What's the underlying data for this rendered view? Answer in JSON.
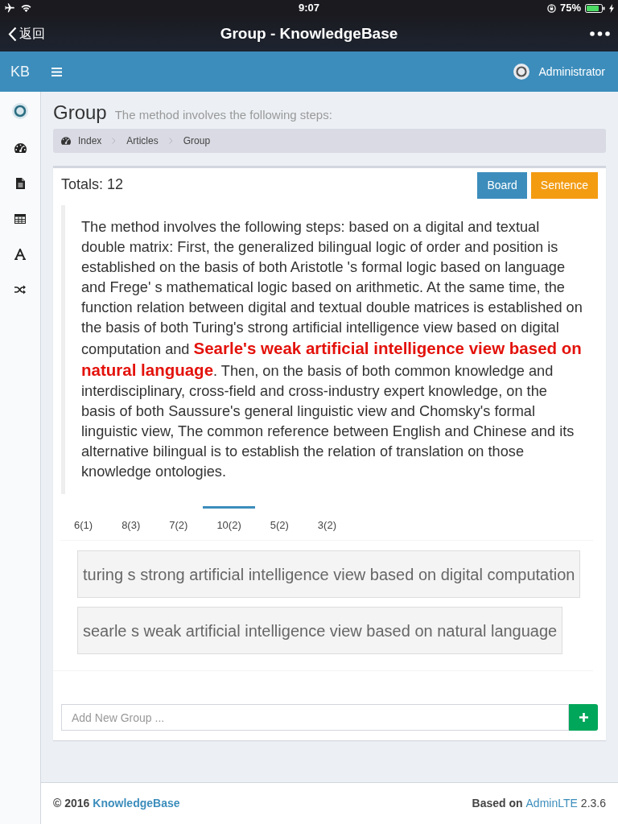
{
  "status_bar": {
    "time": "9:07",
    "battery_text": "75%"
  },
  "nav_bar": {
    "back": "返回",
    "title": "Group - KnowledgeBase"
  },
  "header": {
    "logo": "KB",
    "user": "Administrator"
  },
  "page_header": {
    "title": "Group",
    "subtitle": "The method involves the following steps:"
  },
  "breadcrumb": [
    {
      "label": "Index"
    },
    {
      "label": "Articles"
    },
    {
      "label": "Group"
    }
  ],
  "box": {
    "totals": "Totals: 12",
    "buttons": [
      {
        "label": "Board",
        "kind": "primary"
      },
      {
        "label": "Sentence",
        "kind": "warning"
      }
    ],
    "quote": "The method involves the following steps: based on a digital and textual double matrix: First, the generalized bilingual logic of order and position is established on the basis of both Aristotle 's formal logic based on language and Frege' s mathematical logic based on arithmetic. At the same time, the function relation between digital and textual double matrices is established on the basis of both Turing's strong artificial intelligence view based on digital computation and **Searle's weak artificial intelligence view based on natural language**. Then, on the basis of both common knowledge and interdisciplinary, cross-field and cross-industry expert knowledge, on the basis of both Saussure's general linguistic view and Chomsky's formal linguistic view, The common reference between English and Chinese and its alternative bilingual is to establish the relation of translation on those knowledge ontologies.",
    "tabs": [
      {
        "label": "6(1)",
        "selected": false
      },
      {
        "label": "8(3)",
        "selected": false
      },
      {
        "label": "7(2)",
        "selected": false
      },
      {
        "label": "10(2)",
        "selected": true
      },
      {
        "label": "5(2)",
        "selected": false
      },
      {
        "label": "3(2)",
        "selected": false
      }
    ],
    "groups": [
      "turing s strong artificial intelligence view based on digital computation",
      "searle s weak artificial intelligence view based on natural language"
    ],
    "new_group": {
      "placeholder": "Add New Group ..."
    }
  },
  "footer": {
    "copyright": "© 2016",
    "brand": "KnowledgeBase",
    "based_on": "Based on",
    "framework": "AdminLTE",
    "version": "2.3.6"
  }
}
